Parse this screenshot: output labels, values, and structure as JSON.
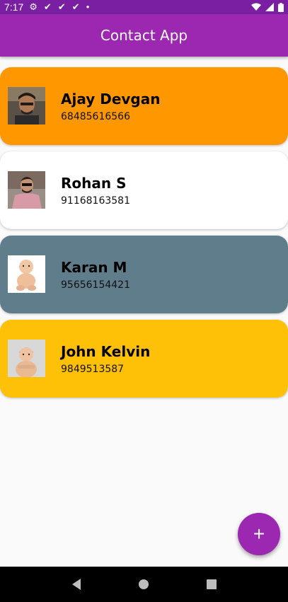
{
  "status_bar": {
    "time": "7:17",
    "icons": [
      "gear-icon",
      "check-icon",
      "check-icon",
      "check-icon",
      "dot-icon"
    ],
    "right_icons": [
      "wifi-icon",
      "signal-icon",
      "battery-icon"
    ]
  },
  "app_bar": {
    "title": "Contact App",
    "color": "#9c27b0"
  },
  "contacts": [
    {
      "name": "Ajay Devgan",
      "phone": "68485616566",
      "color": "#ff9800",
      "avatar": "man-portrait-photo"
    },
    {
      "name": "Rohan S",
      "phone": "91168163581",
      "color": "#ffffff",
      "avatar": "man-portrait-photo"
    },
    {
      "name": "Karan M",
      "phone": "95656154421",
      "color": "#607d8b",
      "avatar": "baby-photo"
    },
    {
      "name": "John Kelvin",
      "phone": "9849513587",
      "color": "#ffc107",
      "avatar": "baby-photo"
    }
  ],
  "fab": {
    "label": "+",
    "icon": "plus-icon"
  },
  "nav_bar": {
    "icons": [
      "back-icon",
      "home-icon",
      "recents-icon"
    ]
  }
}
